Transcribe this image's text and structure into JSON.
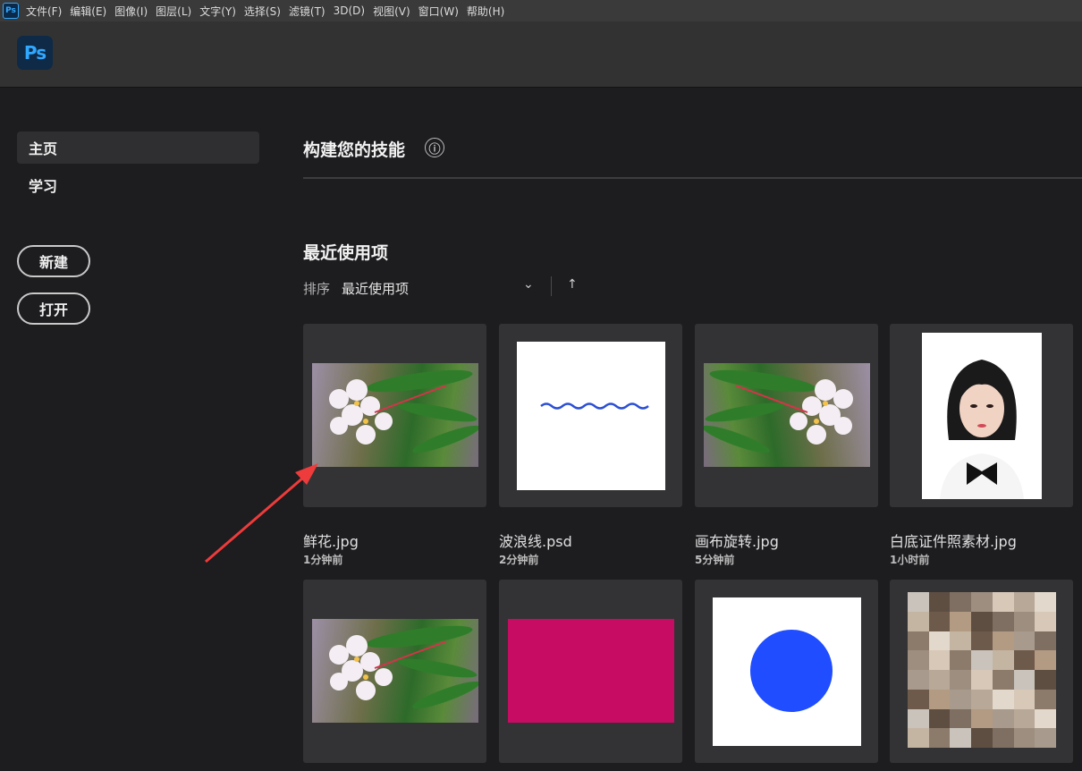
{
  "menubar": {
    "app_icon": "Ps",
    "items": [
      "文件(F)",
      "编辑(E)",
      "图像(I)",
      "图层(L)",
      "文字(Y)",
      "选择(S)",
      "滤镜(T)",
      "3D(D)",
      "视图(V)",
      "窗口(W)",
      "帮助(H)"
    ]
  },
  "header": {
    "logo": "Ps"
  },
  "sidebar": {
    "nav": [
      {
        "label": "主页",
        "active": true
      },
      {
        "label": "学习",
        "active": false
      }
    ],
    "new_label": "新建",
    "open_label": "打开"
  },
  "skills": {
    "title": "构建您的技能",
    "info_icon": "ⓘ"
  },
  "recent": {
    "title": "最近使用项",
    "sort_label": "排序",
    "sort_value": "最近使用项",
    "sort_chevron": "⌄",
    "sort_direction": "↑",
    "files": [
      {
        "name": "鲜花.jpg",
        "time": "1分钟前",
        "thumb": "flower"
      },
      {
        "name": "波浪线.psd",
        "time": "2分钟前",
        "thumb": "wave"
      },
      {
        "name": "画布旋转.jpg",
        "time": "5分钟前",
        "thumb": "flower-flipped"
      },
      {
        "name": "白底证件照素材.jpg",
        "time": "1小时前",
        "thumb": "portrait"
      },
      {
        "name": "",
        "time": "",
        "thumb": "flower"
      },
      {
        "name": "",
        "time": "",
        "thumb": "magenta-rect"
      },
      {
        "name": "",
        "time": "",
        "thumb": "blue-circle"
      },
      {
        "name": "",
        "time": "",
        "thumb": "mosaic"
      }
    ]
  },
  "colors": {
    "accent_blue": "#31a8ff",
    "annotation_arrow": "#ee3b3b",
    "magenta": "#c70c64",
    "circle_blue": "#1f4dff"
  }
}
